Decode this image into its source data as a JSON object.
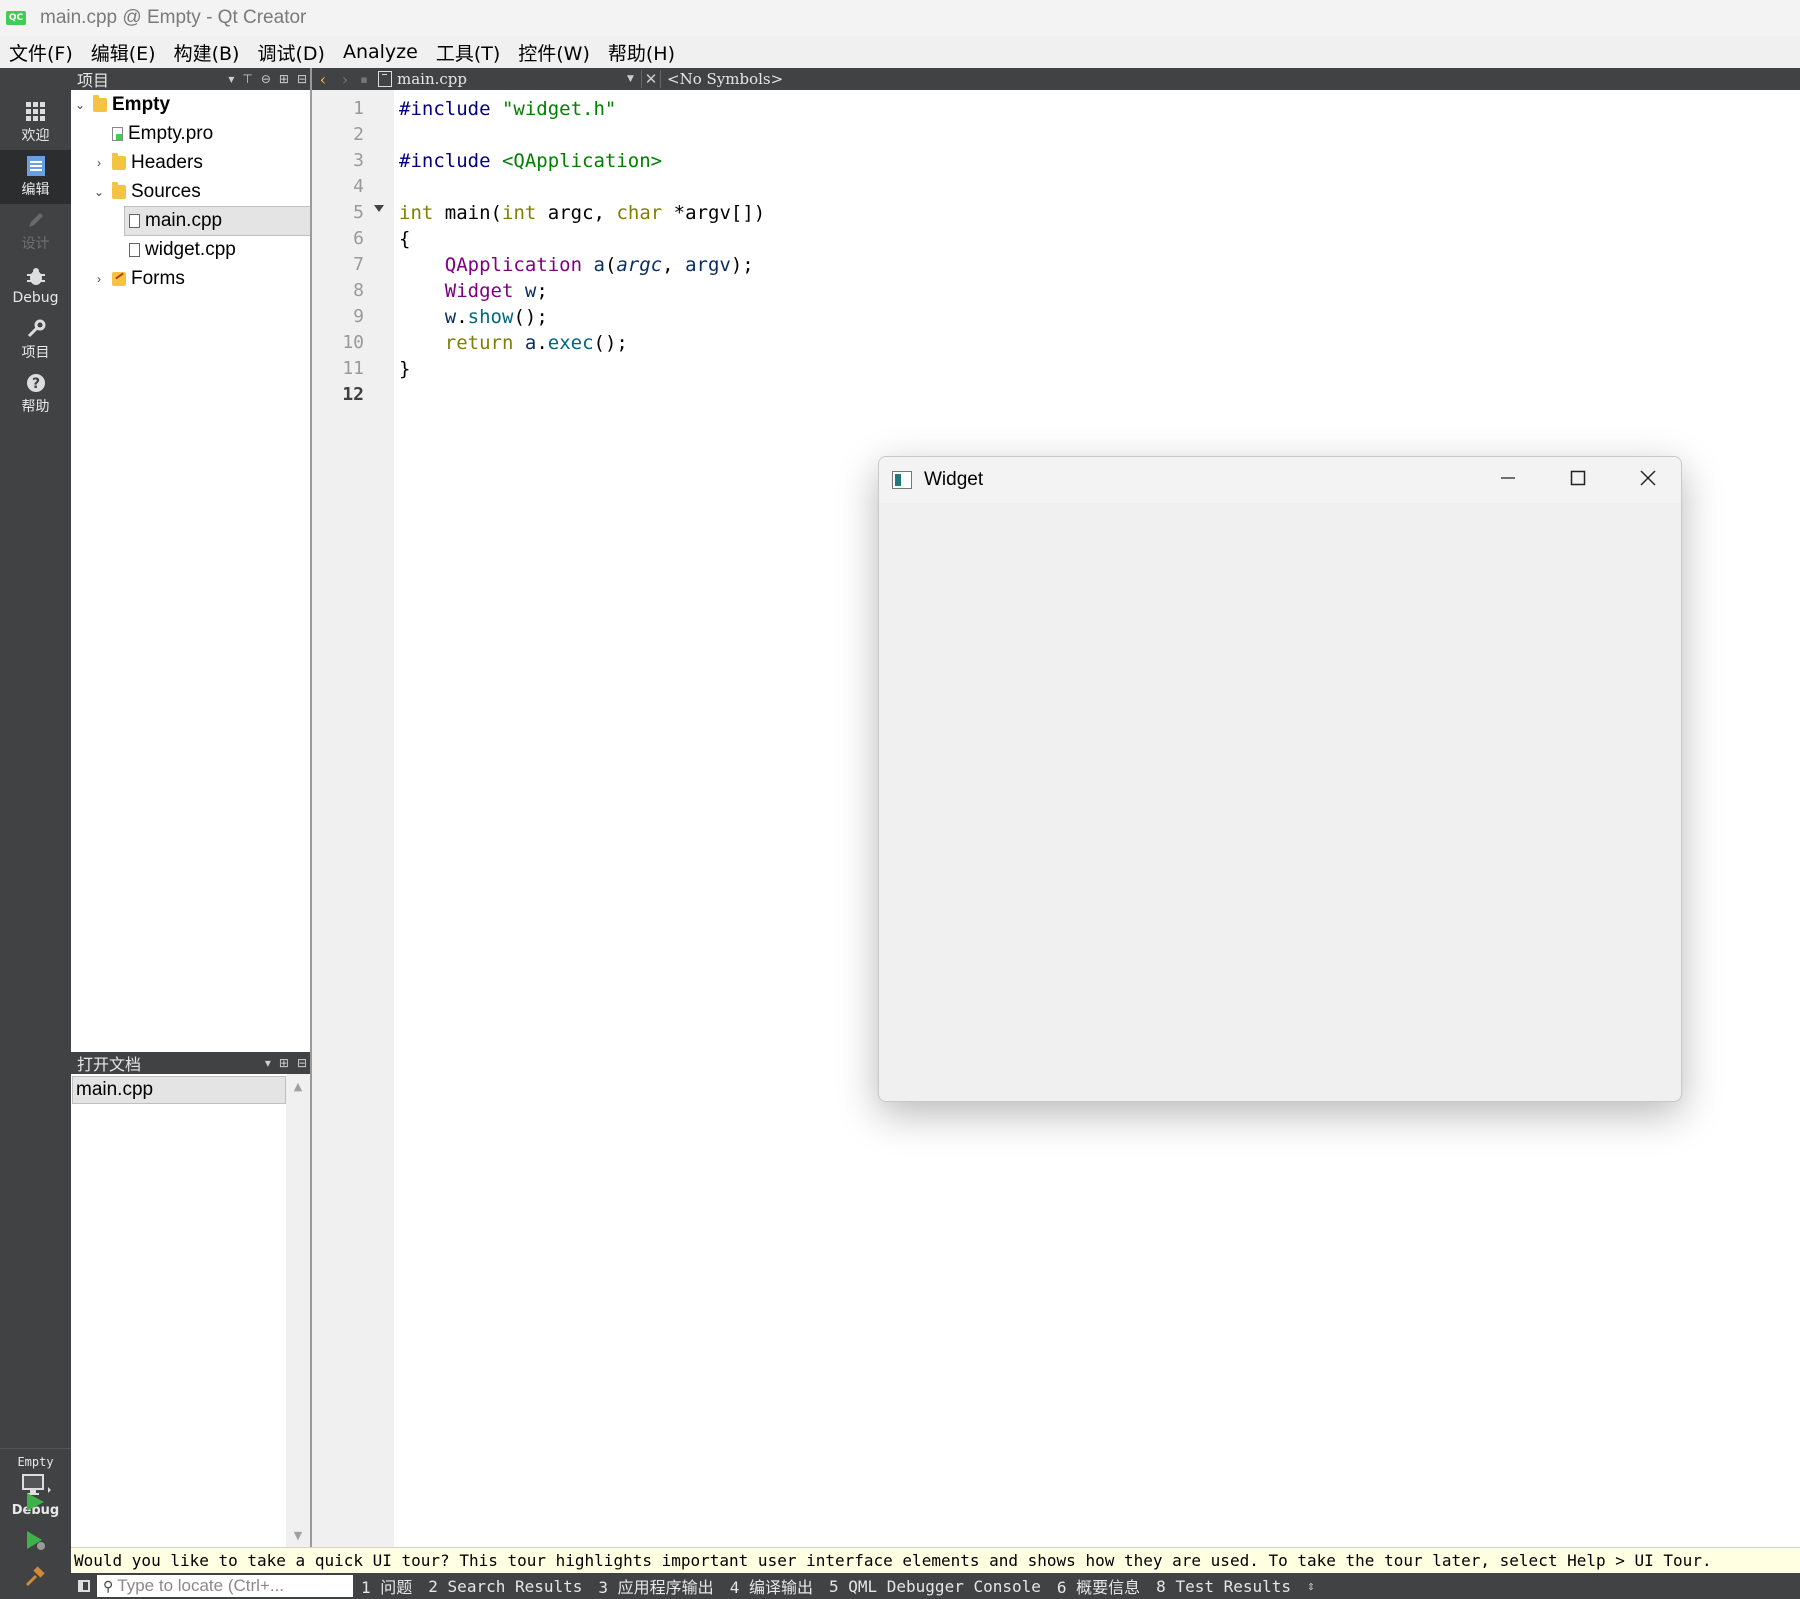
{
  "window": {
    "title": "main.cpp @ Empty - Qt Creator",
    "logo_text": "QC"
  },
  "menubar": {
    "items": [
      "文件(F)",
      "编辑(E)",
      "构建(B)",
      "调试(D)",
      "Analyze",
      "工具(T)",
      "控件(W)",
      "帮助(H)"
    ]
  },
  "modebar": {
    "modes": [
      {
        "label": "欢迎",
        "icon": "grid-icon"
      },
      {
        "label": "编辑",
        "icon": "edit-doc-icon",
        "active": true
      },
      {
        "label": "设计",
        "icon": "pencil-icon",
        "disabled": true
      },
      {
        "label": "Debug",
        "icon": "bug-icon"
      },
      {
        "label": "项目",
        "icon": "wrench-icon"
      },
      {
        "label": "帮助",
        "icon": "help-icon"
      }
    ],
    "kit": {
      "project": "Empty",
      "build_mode": "Debug"
    }
  },
  "project_panel": {
    "header": "项目",
    "tree": [
      {
        "label": "Empty",
        "bold": true,
        "expanded": true
      },
      {
        "label": "Empty.pro"
      },
      {
        "label": "Headers",
        "expanded": false
      },
      {
        "label": "Sources",
        "expanded": true
      },
      {
        "label": "main.cpp",
        "selected": true
      },
      {
        "label": "widget.cpp"
      },
      {
        "label": "Forms",
        "expanded": false
      }
    ]
  },
  "open_documents": {
    "header": "打开文档",
    "items": [
      "main.cpp"
    ]
  },
  "editor": {
    "filename": "main.cpp",
    "symbols": "<No Symbols>",
    "current_line": 12,
    "line_numbers": [
      "1",
      "2",
      "3",
      "4",
      "5",
      "6",
      "7",
      "8",
      "9",
      "10",
      "11",
      "12"
    ],
    "code": {
      "l1_directive": "#include",
      "l1_header": "\"widget.h\"",
      "l3_directive": "#include",
      "l3_header": "<QApplication>",
      "l5_type_int": "int",
      "l5_main": "main",
      "l5_paren_open": "(",
      "l5_param_type": "int",
      "l5_argc": "argc",
      "l5_comma": ",",
      "l5_char": "char",
      "l5_star": "*",
      "l5_argv": "argv",
      "l5_end": "[])",
      "l6": "{",
      "l7_class": "QApplication",
      "l7_var": "a",
      "l7_open": "(",
      "l7_argc": "argc",
      "l7_comma": ",",
      "l7_argv": "argv",
      "l7_end": ");",
      "l8_class": "Widget",
      "l8_var": "w",
      "l8_end": ";",
      "l9_var": "w",
      "l9_dot": ".",
      "l9_fn": "show",
      "l9_end": "();",
      "l10_kw": "return",
      "l10_var": "a",
      "l10_dot": ".",
      "l10_fn": "exec",
      "l10_end": "();",
      "l11": "}"
    }
  },
  "infobar": {
    "text": "Would you like to take a quick UI tour? This tour highlights important user interface elements and shows how they are used. To take the tour later, select Help > UI Tour."
  },
  "statusbar": {
    "locator_placeholder": "Type to locate (Ctrl+...",
    "panes": [
      "1 问题",
      "2 Search Results",
      "3 应用程序输出",
      "4 编译输出",
      "5 QML Debugger Console",
      "6 概要信息",
      "8 Test Results"
    ]
  },
  "widget_window": {
    "title": "Widget"
  },
  "colors": {
    "sidebar_bg": "#404244",
    "editor_bg": "#ffffff",
    "infobar_bg": "#ffffe1",
    "string": "#008000",
    "keyword_type": "#808000",
    "class": "#800080",
    "function": "#00677c",
    "preprocessor": "#000080"
  }
}
